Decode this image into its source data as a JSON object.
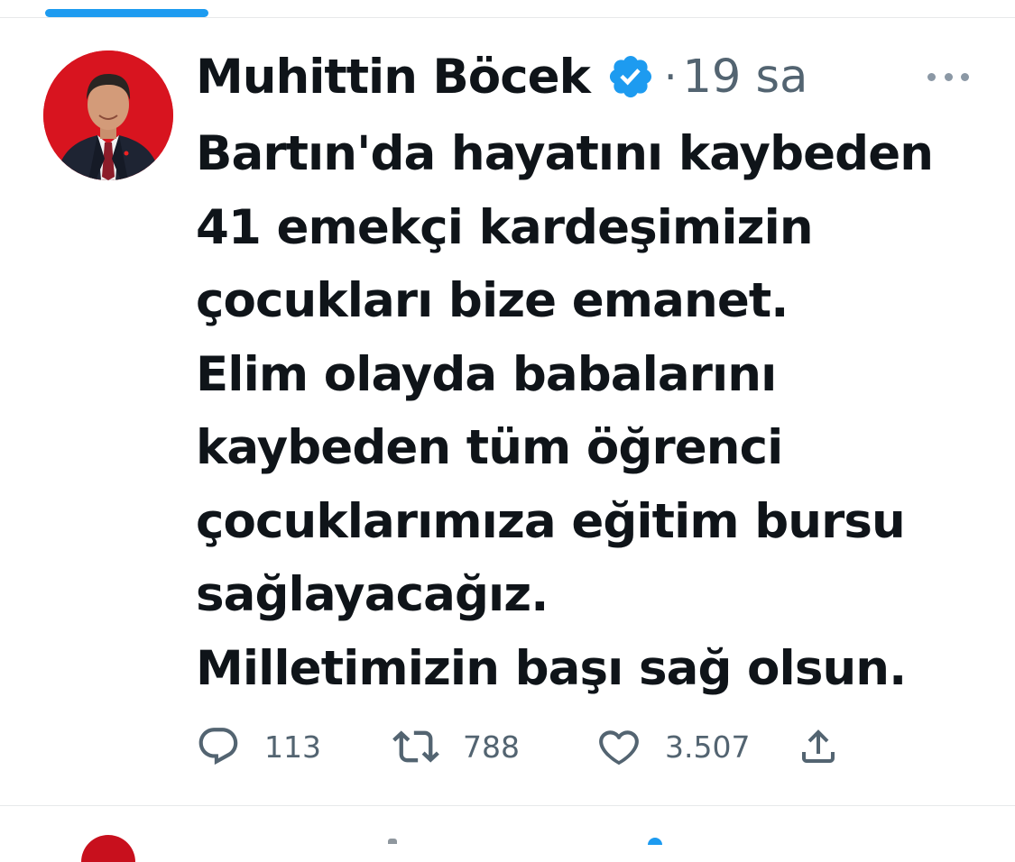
{
  "tweet": {
    "author_name": "Muhittin Böcek",
    "separator": "·",
    "time": "19 sa",
    "text_lines": [
      "Bartın'da hayatını kaybeden",
      "41 emekçi kardeşimizin",
      "çocukları bize emanet.",
      "Elim olayda babalarını",
      "kaybeden tüm öğrenci",
      "çocuklarımıza eğitim bursu",
      "sağlayacağız.",
      "Milletimizin başı sağ olsun."
    ],
    "actions": {
      "reply_count": "113",
      "retweet_count": "788",
      "like_count": "3.507"
    }
  },
  "icons": {
    "verified": "verified-badge-icon",
    "more": "more-options-icon",
    "reply": "reply-icon",
    "retweet": "retweet-icon",
    "like": "heart-icon",
    "share": "share-icon"
  },
  "colors": {
    "accent": "#1d9bf0",
    "text_primary": "#0f1419",
    "text_secondary": "#536471",
    "avatar_background": "#d8141f"
  }
}
